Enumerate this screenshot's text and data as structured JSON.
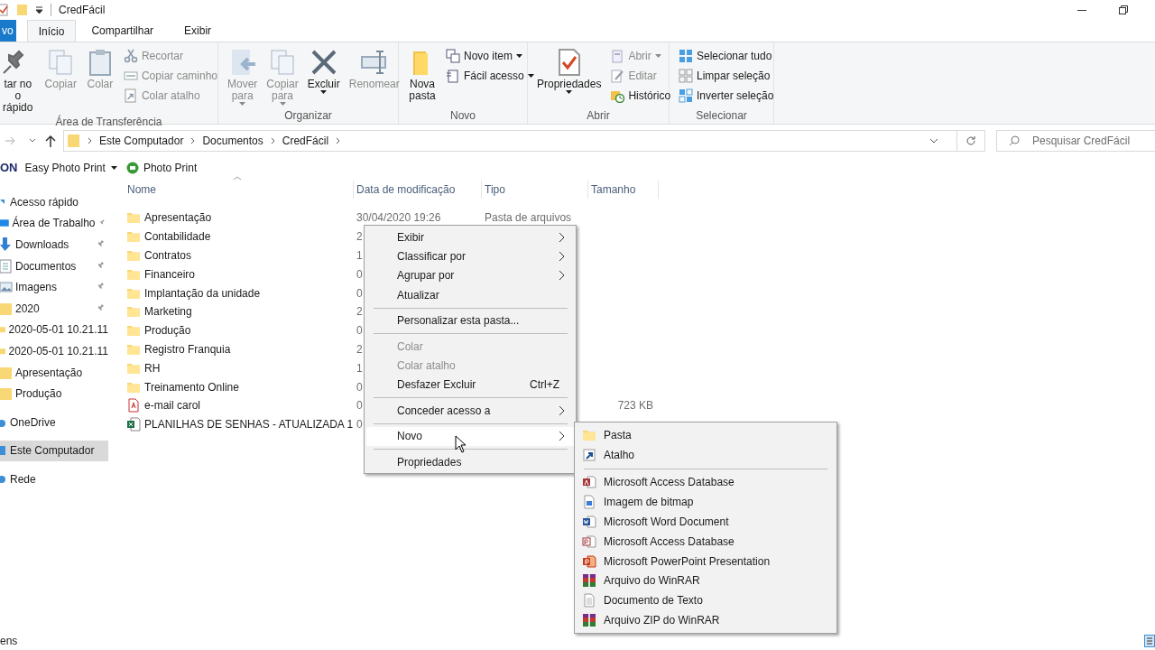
{
  "window": {
    "title": "CredFácil"
  },
  "tabs": [
    {
      "label": "vo",
      "kind": "file",
      "selected": false
    },
    {
      "label": "Início",
      "kind": "tab",
      "selected": true
    },
    {
      "label": "Compartilhar",
      "kind": "tab",
      "selected": false
    },
    {
      "label": "Exibir",
      "kind": "tab",
      "selected": false
    }
  ],
  "ribbon": [
    {
      "name": "Área de Transferência",
      "items": [
        {
          "kind": "large",
          "label": "tar no\no rápido",
          "disabled": false,
          "dropdown": false
        },
        {
          "kind": "large",
          "label": "Copiar",
          "disabled": true,
          "dropdown": false
        },
        {
          "kind": "large",
          "label": "Colar",
          "disabled": true,
          "dropdown": false
        },
        {
          "kind": "stack",
          "items": [
            {
              "label": "Recortar",
              "disabled": true,
              "dropdown": false
            },
            {
              "label": "Copiar caminho",
              "disabled": true,
              "dropdown": false
            },
            {
              "label": "Colar atalho",
              "disabled": true,
              "dropdown": false
            }
          ]
        }
      ]
    },
    {
      "name": "Organizar",
      "items": [
        {
          "kind": "large",
          "label": "Mover\npara",
          "disabled": true,
          "dropdown": true
        },
        {
          "kind": "large",
          "label": "Copiar\npara",
          "disabled": true,
          "dropdown": true
        },
        {
          "kind": "large",
          "label": "Excluir",
          "disabled": false,
          "dropdown": true
        },
        {
          "kind": "large",
          "label": "Renomear",
          "disabled": true,
          "dropdown": false
        }
      ]
    },
    {
      "name": "Novo",
      "items": [
        {
          "kind": "large",
          "label": "Nova\npasta",
          "disabled": false,
          "dropdown": false
        },
        {
          "kind": "stack",
          "items": [
            {
              "label": "Novo item",
              "disabled": false,
              "dropdown": true
            },
            {
              "label": "Fácil acesso",
              "disabled": false,
              "dropdown": true
            }
          ]
        }
      ]
    },
    {
      "name": "Abrir",
      "items": [
        {
          "kind": "large",
          "label": "Propriedades",
          "disabled": false,
          "dropdown": true
        },
        {
          "kind": "stack",
          "items": [
            {
              "label": "Abrir",
              "disabled": true,
              "dropdown": true
            },
            {
              "label": "Editar",
              "disabled": true,
              "dropdown": false
            },
            {
              "label": "Histórico",
              "disabled": false,
              "dropdown": false
            }
          ]
        }
      ]
    },
    {
      "name": "Selecionar",
      "items": [
        {
          "kind": "stack",
          "items": [
            {
              "label": "Selecionar tudo",
              "disabled": false,
              "dropdown": false
            },
            {
              "label": "Limpar seleção",
              "disabled": false,
              "dropdown": false
            },
            {
              "label": "Inverter seleção",
              "disabled": false,
              "dropdown": false
            }
          ]
        }
      ]
    }
  ],
  "address": {
    "crumbs": [
      "Este Computador",
      "Documentos",
      "CredFácil"
    ]
  },
  "search": {
    "placeholder": "Pesquisar CredFácil"
  },
  "toolbar": {
    "brand": "ON",
    "items": [
      "Easy Photo Print",
      "Photo Print"
    ]
  },
  "nav": [
    {
      "label": "Acesso rápido",
      "selected": false,
      "children": [
        {
          "label": "Área de Trabalho",
          "pinned": true,
          "selected": false
        },
        {
          "label": "Downloads",
          "pinned": true,
          "selected": false
        },
        {
          "label": "Documentos",
          "pinned": true,
          "selected": false
        },
        {
          "label": "Imagens",
          "pinned": true,
          "selected": false
        },
        {
          "label": "2020",
          "pinned": true,
          "selected": false
        },
        {
          "label": "2020-05-01 10.21.11",
          "pinned": false,
          "selected": false
        },
        {
          "label": "2020-05-01 10.21.11",
          "pinned": false,
          "selected": false
        },
        {
          "label": "Apresentação",
          "pinned": false,
          "selected": false
        },
        {
          "label": "Produção",
          "pinned": false,
          "selected": false
        }
      ]
    },
    {
      "label": "OneDrive",
      "selected": false
    },
    {
      "label": "Este Computador",
      "selected": true
    },
    {
      "label": "Rede",
      "selected": false
    }
  ],
  "table": {
    "columns": [
      "Nome",
      "Data de modificação",
      "Tipo",
      "Tamanho"
    ],
    "rows": [
      {
        "name": "Apresentação",
        "kind": "folder",
        "date": "30/04/2020 19:26",
        "type": "Pasta de arquivos"
      },
      {
        "name": "Contabilidade",
        "kind": "folder",
        "date": "2"
      },
      {
        "name": "Contratos",
        "kind": "folder",
        "date": "1"
      },
      {
        "name": "Financeiro",
        "kind": "folder",
        "date": "0"
      },
      {
        "name": "Implantação da unidade",
        "kind": "folder",
        "date": "0"
      },
      {
        "name": "Marketing",
        "kind": "folder",
        "date": "2"
      },
      {
        "name": "Produção",
        "kind": "folder",
        "date": "0"
      },
      {
        "name": "Registro Franquia",
        "kind": "folder",
        "date": "2"
      },
      {
        "name": "RH",
        "kind": "folder",
        "date": "1"
      },
      {
        "name": "Treinamento Online",
        "kind": "folder",
        "date": "0"
      },
      {
        "name": "e-mail carol",
        "kind": "pdf",
        "date": "0",
        "size": "723 KB"
      },
      {
        "name": "PLANILHAS DE SENHAS - ATUALIZADA 1",
        "kind": "spreadsheet",
        "date": "0"
      }
    ]
  },
  "context_menu": [
    {
      "kind": "item",
      "label": "Exibir",
      "submenu": true,
      "disabled": false,
      "selected": false
    },
    {
      "kind": "item",
      "label": "Classificar por",
      "submenu": true,
      "disabled": false,
      "selected": false
    },
    {
      "kind": "item",
      "label": "Agrupar por",
      "submenu": true,
      "disabled": false,
      "selected": false
    },
    {
      "kind": "item",
      "label": "Atualizar",
      "submenu": false,
      "disabled": false,
      "selected": false
    },
    {
      "kind": "separator"
    },
    {
      "kind": "item",
      "label": "Personalizar esta pasta...",
      "submenu": false,
      "disabled": false,
      "selected": false
    },
    {
      "kind": "separator"
    },
    {
      "kind": "item",
      "label": "Colar",
      "submenu": false,
      "disabled": true,
      "selected": false
    },
    {
      "kind": "item",
      "label": "Colar atalho",
      "submenu": false,
      "disabled": true,
      "selected": false
    },
    {
      "kind": "item",
      "label": "Desfazer Excluir",
      "shortcut": "Ctrl+Z",
      "submenu": false,
      "disabled": false,
      "selected": false
    },
    {
      "kind": "separator"
    },
    {
      "kind": "item",
      "label": "Conceder acesso a",
      "submenu": true,
      "disabled": false,
      "selected": false
    },
    {
      "kind": "separator"
    },
    {
      "kind": "item",
      "label": "Novo",
      "submenu": true,
      "disabled": false,
      "selected": true
    },
    {
      "kind": "separator"
    },
    {
      "kind": "item",
      "label": "Propriedades",
      "submenu": false,
      "disabled": false,
      "selected": false
    }
  ],
  "submenu": [
    {
      "kind": "folder",
      "label": "Pasta"
    },
    {
      "kind": "shortcut",
      "label": "Atalho"
    },
    {
      "kind": "separator"
    },
    {
      "kind": "access",
      "label": "Microsoft Access Database"
    },
    {
      "kind": "bitmap",
      "label": "Imagem de bitmap"
    },
    {
      "kind": "word",
      "label": "Microsoft Word Document"
    },
    {
      "kind": "publisher",
      "label": "Microsoft Access Database"
    },
    {
      "kind": "powerpoint",
      "label": "Microsoft PowerPoint Presentation"
    },
    {
      "kind": "archive",
      "label": "Arquivo do WinRAR"
    },
    {
      "kind": "text",
      "label": "Documento de Texto"
    },
    {
      "kind": "archive",
      "label": "Arquivo ZIP do WinRAR"
    }
  ],
  "status_bar": {
    "text": "ens"
  }
}
